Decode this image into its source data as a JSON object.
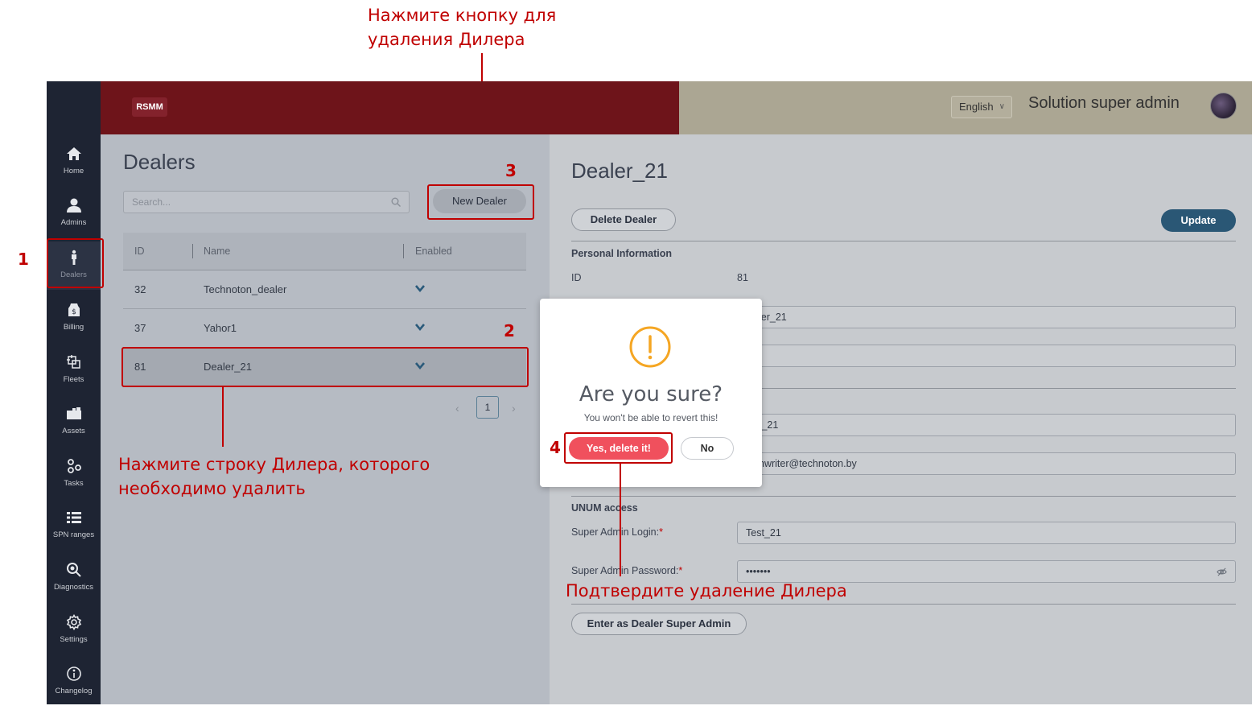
{
  "annotations": {
    "top_instruction_line1": "Нажмите кнопку для",
    "top_instruction_line2": "удаления Дилера",
    "row_instruction_line1": "Нажмите строку Дилера, которого",
    "row_instruction_line2": "необходимо удалить",
    "confirm_instruction": "Подтвердите удаление Дилера",
    "step1": "1",
    "step2": "2",
    "step3": "3",
    "step4": "4",
    "color": "#c00000"
  },
  "header": {
    "logo": "RSMM",
    "language": "English",
    "user_name": "Solution super admin",
    "left_color": "#6e141a",
    "right_color": "#aba693"
  },
  "sidebar": {
    "items": [
      {
        "label": "Home",
        "icon": "home-icon"
      },
      {
        "label": "Admins",
        "icon": "user-icon"
      },
      {
        "label": "Dealers",
        "icon": "person-icon"
      },
      {
        "label": "Billing",
        "icon": "billing-icon"
      },
      {
        "label": "Fleets",
        "icon": "fleets-icon"
      },
      {
        "label": "Assets",
        "icon": "assets-icon"
      },
      {
        "label": "Tasks",
        "icon": "tasks-icon"
      },
      {
        "label": "SPN ranges",
        "icon": "list-icon"
      },
      {
        "label": "Diagnostics",
        "icon": "search-zoom-icon"
      },
      {
        "label": "Settings",
        "icon": "gear-icon"
      },
      {
        "label": "Changelog",
        "icon": "info-icon"
      }
    ]
  },
  "dealers": {
    "title": "Dealers",
    "search_placeholder": "Search...",
    "new_button": "New Dealer",
    "columns": [
      "ID",
      "Name",
      "Enabled"
    ],
    "rows": [
      {
        "id": "32",
        "name": "Technoton_dealer"
      },
      {
        "id": "37",
        "name": "Yahor1"
      },
      {
        "id": "81",
        "name": "Dealer_21"
      }
    ],
    "page": "1"
  },
  "detail": {
    "title": "Dealer_21",
    "delete_button": "Delete Dealer",
    "update_button": "Update",
    "personal_section": "Personal Information",
    "id_label": "ID",
    "id_value": "81",
    "name_value_visible": "ler_21",
    "login_partial_visible": "t_21",
    "email_visible": "hwriter@technoton.by",
    "unum_section": "UNUM access",
    "login_label": "Super Admin Login:",
    "login_value": "Test_21",
    "password_label": "Super Admin Password:",
    "password_value": "•••••••",
    "enter_button": "Enter as Dealer Super Admin",
    "required_mark": "*"
  },
  "modal": {
    "title": "Are you sure?",
    "text": "You won't be able to revert this!",
    "confirm": "Yes, delete it!",
    "cancel": "No",
    "icon": "warning-icon",
    "icon_color": "#f5a623",
    "confirm_color": "#f0505d"
  }
}
